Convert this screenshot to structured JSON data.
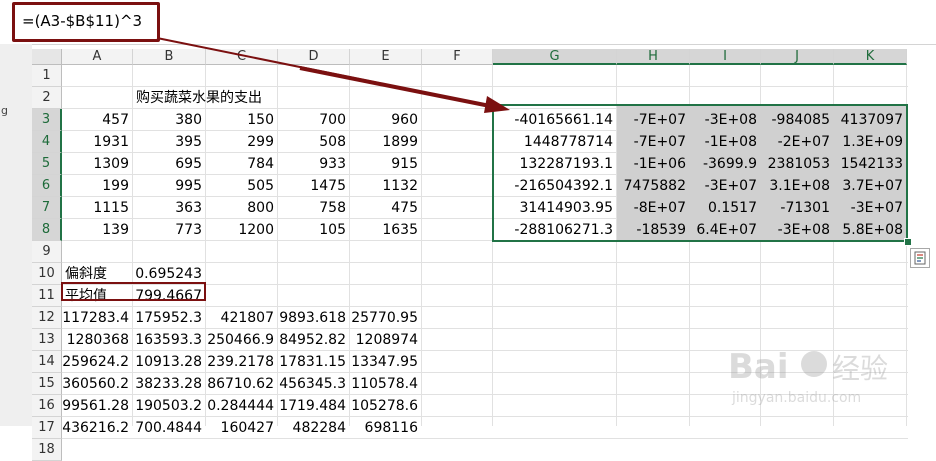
{
  "formula_bar": {
    "formula": "=(A3-$B$11)^3"
  },
  "columns": [
    "A",
    "B",
    "C",
    "D",
    "E",
    "F",
    "G",
    "H",
    "I",
    "J",
    "K"
  ],
  "rows": [
    "1",
    "2",
    "3",
    "4",
    "5",
    "6",
    "7",
    "8",
    "9",
    "10",
    "11",
    "12",
    "13",
    "14",
    "15",
    "16",
    "17",
    "18"
  ],
  "title_cell": "购买蔬菜水果的支出",
  "data_block": [
    [
      "457",
      "380",
      "150",
      "700",
      "960"
    ],
    [
      "1931",
      "395",
      "299",
      "508",
      "1899"
    ],
    [
      "1309",
      "695",
      "784",
      "933",
      "915"
    ],
    [
      "199",
      "995",
      "505",
      "1475",
      "1132"
    ],
    [
      "1115",
      "363",
      "800",
      "758",
      "475"
    ],
    [
      "139",
      "773",
      "1200",
      "105",
      "1635"
    ]
  ],
  "skewness": {
    "label": "偏斜度",
    "value": "0.695243"
  },
  "mean": {
    "label": "平均值",
    "value": "799.4667"
  },
  "cube_block": [
    [
      "117283.4",
      "175952.3",
      "421807",
      "9893.618",
      "25770.95"
    ],
    [
      "1280368",
      "163593.3",
      "250466.9",
      "84952.82",
      "1208974"
    ],
    [
      "259624.2",
      "10913.28",
      "239.2178",
      "17831.15",
      "13347.95"
    ],
    [
      "360560.2",
      "38233.28",
      "86710.62",
      "456345.3",
      "110578.4"
    ],
    [
      "99561.28",
      "190503.2",
      "0.284444",
      "1719.484",
      "105278.6"
    ],
    [
      "436216.2",
      "700.4844",
      "160427",
      "482284",
      "698116"
    ]
  ],
  "result_block": [
    [
      "-40165661.14",
      "-7E+07",
      "-3E+08",
      "-984085",
      "4137097"
    ],
    [
      "1448778714",
      "-7E+07",
      "-1E+08",
      "-2E+07",
      "1.3E+09"
    ],
    [
      "132287193.1",
      "-1E+06",
      "-3699.9",
      "2381053",
      "1542133"
    ],
    [
      "-216504392.1",
      "7475882",
      "-3E+07",
      "3.1E+08",
      "3.7E+07"
    ],
    [
      "31414903.95",
      "-8E+07",
      "0.1517",
      "-71301",
      "-3E+07"
    ],
    [
      "-288106271.3",
      "-18539",
      "6.4E+07",
      "-3E+08",
      "5.8E+08"
    ]
  ],
  "left_edge_text": "g",
  "colors": {
    "annotation": "#7b1010",
    "selection": "#217346",
    "shade": "#d0d0d0"
  }
}
